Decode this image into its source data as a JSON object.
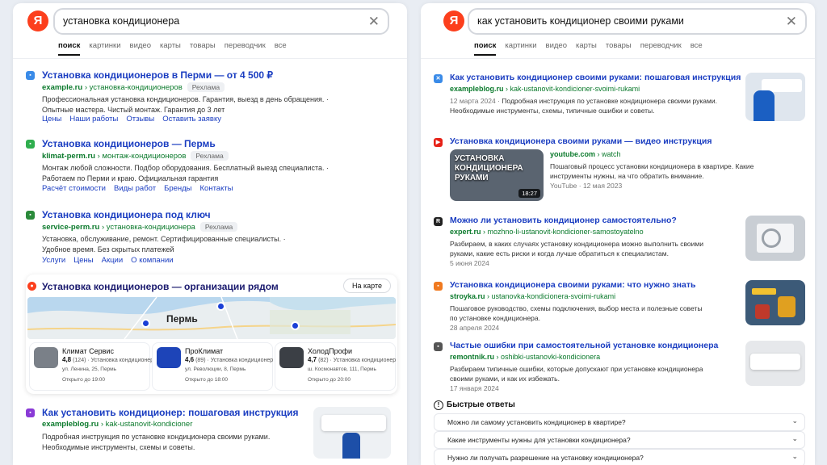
{
  "left": {
    "logo": "Я",
    "query": "установка кондиционера",
    "tabs": [
      "поиск",
      "картинки",
      "видео",
      "карты",
      "товары",
      "переводчик",
      "все"
    ],
    "results": [
      {
        "title": "Установка кондиционеров в Перми — от 4 500 ₽",
        "domain": "example.ru",
        "path": "› установка-кондиционеров",
        "badge": "Рехлама",
        "snippet1": "Профессиональная установка кондиционеров. Гарантия, выезд в день обращения. ·",
        "snippet2": "Опытные мастера. Чистый монтаж. Гарантия до 3 лет",
        "links": [
          "Цены",
          "Наши работы",
          "Отзывы",
          "Оставить заявку"
        ]
      },
      {
        "title": "Установка кондиционеров — Пермь",
        "domain": "klimat-perm.ru",
        "path": "› монтаж-кондиционеров",
        "badge": "Рехлама",
        "snippet1": "Монтаж любой сложности. Подбор оборудования. Бесплатный выезд специалиста. ·",
        "snippet2": "Работаем по Перми и краю. Официальная гарантия",
        "links": [
          "Расчёт стоимости",
          "Виды работ",
          "Бренды",
          "Контакты"
        ]
      },
      {
        "title": "Установка кондиционера под ключ",
        "domain": "service-perm.ru",
        "path": "› установка-кондиционера",
        "badge": "Рехлама",
        "snippet1": "Установка, обслуживание, ремонт. Сертифицированные специалисты. ·",
        "snippet2": "Удобное время. Без скрытых платежей",
        "links": [
          "Услуги",
          "Цены",
          "Акции",
          "О компании"
        ]
      }
    ],
    "maps": {
      "title": "Установка кондиционеров — организации рядом",
      "button": "На карте",
      "city": "Пермь",
      "places": [
        {
          "name": "Климат Сервис",
          "rating": "4,8",
          "reviews": "(124) · Установка кондиционер",
          "address": "ул. Ленина, 25, Пермь",
          "hours": "Открыто до 19:00"
        },
        {
          "name": "ПроКлимат",
          "rating": "4,6",
          "reviews": "(89) · Установка кондиционер",
          "address": "ул. Революции, 8, Пермь",
          "hours": "Открыто до 18:00"
        },
        {
          "name": "ХолодПрофи",
          "rating": "4,7",
          "reviews": "(82) · Установка кондиционер",
          "address": "ш. Космонавтов, 111, Пермь",
          "hours": "Открыто до 20:00"
        }
      ]
    },
    "last": {
      "title": "Как установить кондиционер: пошаговая инструкция",
      "domain": "exampleblog.ru",
      "path": "› kak-ustanovit-kondicioner",
      "snippet1": "Подробная инструкция по установке кондиционера своими руками.",
      "snippet2": "Необходимые инструменты, схемы и советы."
    }
  },
  "right": {
    "logo": "Я",
    "query": "как установить кондиционер своими руками",
    "tabs": [
      "поиск",
      "картинки",
      "видео",
      "карты",
      "товары",
      "переводчик",
      "все"
    ],
    "results": [
      {
        "title": "Как установить кондиционер своими руками: пошаговая инструкция",
        "domain": "exampleblog.ru",
        "path": "› kak-ustanovit-kondicioner-svoimi-rukami",
        "date": "12 марта 2024 ·",
        "snippet1": "Подробная инструкция по установке кондиционера своими руками.",
        "snippet2": "Необходимые инструменты, схемы, типичные ошибки и советы."
      },
      {
        "title": "Установка кондиционера своими руками — видео инструкция",
        "domain": "youtube.com",
        "path": "› watch",
        "snippet1": "Пошаговый процесс установки кондиционера в квартире. Какие",
        "snippet2": "инструменты нужны, на что обратить внимание.",
        "meta": "YouTube · 12 мая 2023",
        "video_text": "УСТАНОВКА КОНДИЦИОНЕРА РУКАМИ",
        "duration": "18:27"
      },
      {
        "title": "Можно ли установить кондиционер самостоятельно?",
        "domain": "expert.ru",
        "path": "› mozhno-li-ustanovit-kondicioner-samostoyatelno",
        "snippet1": "Разбираем, в каких случаях установку кондиционера можно выполнить своими",
        "snippet2": "руками, какие есть риски и когда лучше обратиться к специалистам.",
        "date": "5 июня 2024"
      },
      {
        "title": "Установка кондиционера своими руками: что нужно знать",
        "domain": "stroyka.ru",
        "path": "› ustanovka-kondicionera-svoimi-rukami",
        "snippet1": "Пошаговое руководство, схемы подключения, выбор места и полезные советы",
        "snippet2": "по установке кондиционера.",
        "date": "28 апреля 2024"
      },
      {
        "title": "Частые ошибки при самостоятельной установке кондиционера",
        "domain": "remontnik.ru",
        "path": "› oshibki-ustanovki-kondicionera",
        "snippet1": "Разбираем типичные ошибки, которые допускают при установке кондиционера",
        "snippet2": "своими руками, и как их избежать.",
        "date": "17 января 2024"
      }
    ],
    "quick": {
      "title": "Быстрые ответы",
      "questions": [
        "Можно ли самому установить кондиционер в квартире?",
        "Какие инструменты нужны для установки кондиционера?",
        "Нужно ли получать разрешение на установку кондиционера?"
      ]
    }
  },
  "colors": {
    "link": "#1a3dc1",
    "url": "#0b7a2c",
    "brand": "#fc3f1d"
  }
}
